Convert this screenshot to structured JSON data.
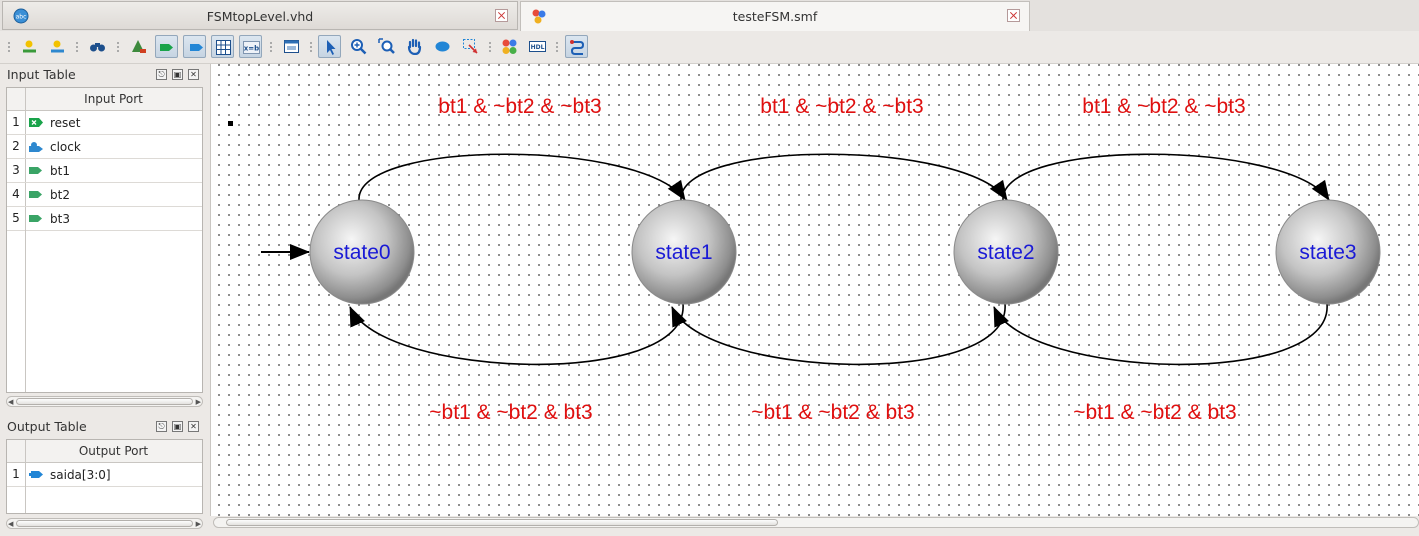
{
  "tabs": [
    {
      "title": "FSMtopLevel.vhd",
      "icon": "abc-file-icon"
    },
    {
      "title": "testeFSM.smf",
      "icon": "fsm-file-icon"
    }
  ],
  "input_panel": {
    "title": "Input Table",
    "column_header": "Input Port",
    "rows": [
      {
        "num": "1",
        "name": "reset",
        "icon": "reset-port-icon"
      },
      {
        "num": "2",
        "name": "clock",
        "icon": "clock-port-icon"
      },
      {
        "num": "3",
        "name": "bt1",
        "icon": "input-port-icon"
      },
      {
        "num": "4",
        "name": "bt2",
        "icon": "input-port-icon"
      },
      {
        "num": "5",
        "name": "bt3",
        "icon": "input-port-icon"
      }
    ]
  },
  "output_panel": {
    "title": "Output Table",
    "column_header": "Output Port",
    "rows": [
      {
        "num": "1",
        "name": "saida[3:0]",
        "icon": "output-bus-port-icon"
      }
    ]
  },
  "fsm": {
    "states": [
      "state0",
      "state1",
      "state2",
      "state3"
    ],
    "forward_conditions": [
      "bt1 & ~bt2 & ~bt3",
      "bt1 & ~bt2 & ~bt3",
      "bt1 & ~bt2 & ~bt3"
    ],
    "backward_conditions": [
      "~bt1 & ~bt2 & bt3",
      "~bt1 & ~bt2 & bt3",
      "~bt1 & ~bt2 & bt3"
    ],
    "colors": {
      "state_label": "#1a1ad6",
      "condition": "#e01010",
      "arrow": "#000000"
    }
  }
}
